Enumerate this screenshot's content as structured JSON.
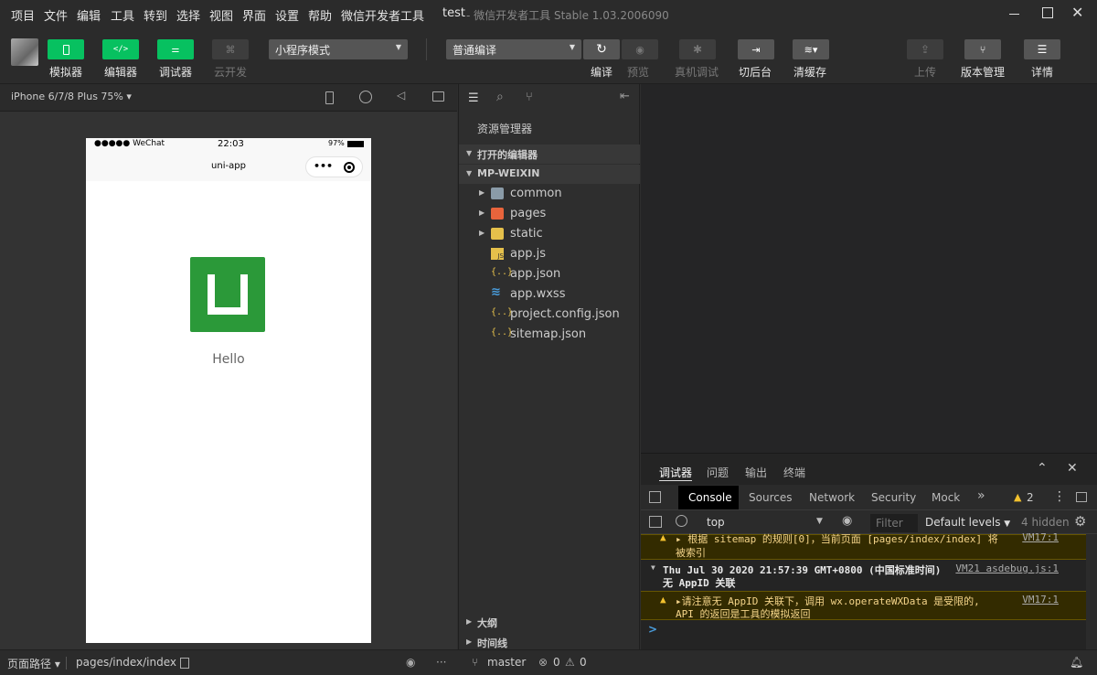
{
  "menu": [
    "项目",
    "文件",
    "编辑",
    "工具",
    "转到",
    "选择",
    "视图",
    "界面",
    "设置",
    "帮助",
    "微信开发者工具"
  ],
  "window": {
    "project": "test",
    "title": "- 微信开发者工具 Stable 1.03.2006090"
  },
  "toolbar": {
    "simulator": "模拟器",
    "editor": "编辑器",
    "debugger": "调试器",
    "cloud": "云开发",
    "mode_select": "小程序模式",
    "compile_select": "普通编译",
    "compile": "编译",
    "preview": "预览",
    "real_debug": "真机调试",
    "background": "切后台",
    "clear_cache": "清缓存",
    "upload": "上传",
    "version": "版本管理",
    "details": "详情"
  },
  "simulator": {
    "device": "iPhone 6/7/8 Plus 75%",
    "status_left": "●●●●● WeChat",
    "status_time": "22:03",
    "status_battery": "97%",
    "nav_title": "uni-app",
    "capsule_dots": "•••",
    "content_text": "Hello"
  },
  "explorer": {
    "title": "资源管理器",
    "open_editors": "打开的编辑器",
    "project": "MP-WEIXIN",
    "items": [
      {
        "name": "common",
        "type": "folder"
      },
      {
        "name": "pages",
        "type": "folder-pages"
      },
      {
        "name": "static",
        "type": "folder-static"
      },
      {
        "name": "app.js",
        "type": "js"
      },
      {
        "name": "app.json",
        "type": "json"
      },
      {
        "name": "app.wxss",
        "type": "wxss"
      },
      {
        "name": "project.config.json",
        "type": "json"
      },
      {
        "name": "sitemap.json",
        "type": "json"
      }
    ],
    "outline": "大纲",
    "timeline": "时间线"
  },
  "devtools": {
    "tabs": [
      "调试器",
      "问题",
      "输出",
      "终端"
    ],
    "console_tabs": [
      "Console",
      "Sources",
      "Network",
      "Security",
      "Mock"
    ],
    "more": "»",
    "warn_count": "2",
    "context": "top",
    "filter_placeholder": "Filter",
    "levels": "Default levels",
    "hidden": "4 hidden",
    "logs": {
      "w1_text": "▸ 根据 sitemap 的规则[0]，当前页面 [pages/index/index] 将",
      "w1_text2": "被索引",
      "w1_link": "VM17:1",
      "info_text": "Thu Jul 30 2020 21:57:39 GMT+0800 (中国标准时间)",
      "info_link": "VM21 asdebug.js:1",
      "info_text2": "无 AppID 关联",
      "w2_text": "▸请注意无 AppID 关联下，调用 wx.operateWXData 是受限的,",
      "w2_text2": "API 的返回是工具的模拟返回",
      "w2_link": "VM17:1",
      "prompt": ">"
    }
  },
  "statusbar": {
    "page_path_label": "页面路径",
    "page_path": "pages/index/index",
    "branch": "master",
    "errors": "0",
    "warnings": "0"
  },
  "colors": {
    "accent": "#07c160",
    "logo": "#2b9939",
    "warning": "#f4d48a"
  }
}
